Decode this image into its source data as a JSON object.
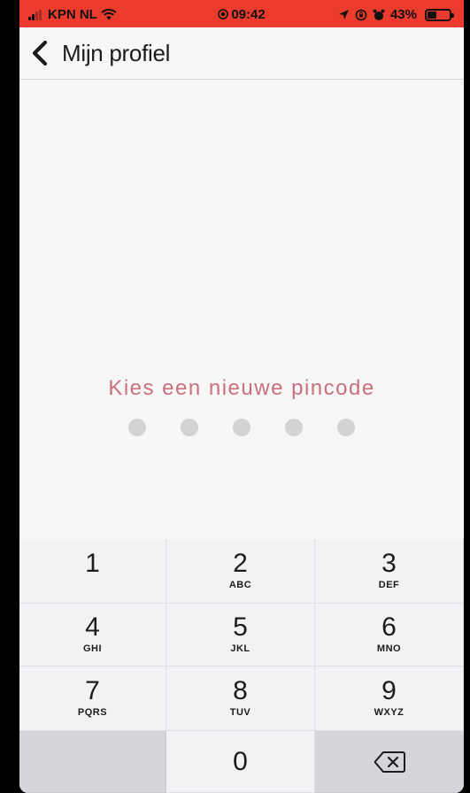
{
  "status_bar": {
    "carrier": "KPN NL",
    "time": "09:42",
    "battery": "43%",
    "battery_level": 0.43,
    "color": "#ea3b2d"
  },
  "nav": {
    "back_icon": "chevron-left-icon",
    "title": "Mijn profiel"
  },
  "pin": {
    "prompt": "Kies een nieuwe pincode",
    "prompt_color": "#c9717a",
    "dots_total": 5,
    "dots_filled": 0
  },
  "keypad": {
    "keys": [
      {
        "digit": "1",
        "letters": ""
      },
      {
        "digit": "2",
        "letters": "ABC"
      },
      {
        "digit": "3",
        "letters": "DEF"
      },
      {
        "digit": "4",
        "letters": "GHI"
      },
      {
        "digit": "5",
        "letters": "JKL"
      },
      {
        "digit": "6",
        "letters": "MNO"
      },
      {
        "digit": "7",
        "letters": "PQRS"
      },
      {
        "digit": "8",
        "letters": "TUV"
      },
      {
        "digit": "9",
        "letters": "WXYZ"
      },
      {
        "digit": "0",
        "letters": ""
      }
    ],
    "delete_icon": "backspace-icon"
  }
}
